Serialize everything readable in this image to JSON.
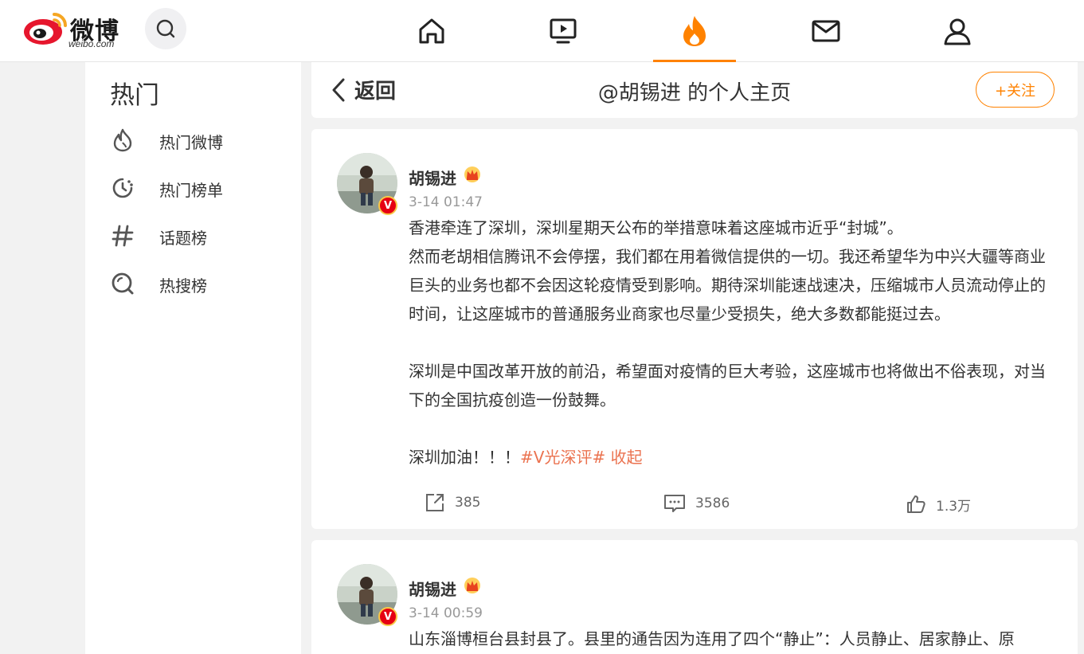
{
  "brand": {
    "logo_text": "微博",
    "logo_sub": "weibo.com"
  },
  "colors": {
    "accent": "#ff8200",
    "topic": "#eb7350",
    "verified": "#e60012"
  },
  "topnav": [
    {
      "name": "home",
      "icon": "home-icon"
    },
    {
      "name": "video",
      "icon": "video-icon"
    },
    {
      "name": "hot",
      "icon": "fire-icon",
      "active": true
    },
    {
      "name": "messages",
      "icon": "mail-icon"
    },
    {
      "name": "profile",
      "icon": "user-icon"
    }
  ],
  "sidebar": {
    "title": "热门",
    "items": [
      {
        "label": "热门微博",
        "icon": "flame-icon"
      },
      {
        "label": "热门榜单",
        "icon": "clock-icon"
      },
      {
        "label": "话题榜",
        "icon": "hashtag-icon"
      },
      {
        "label": "热搜榜",
        "icon": "search-ring-icon"
      }
    ]
  },
  "header": {
    "back_label": "返回",
    "title": "@胡锡进 的个人主页",
    "follow_label": "+关注"
  },
  "posts": [
    {
      "author": "胡锡进",
      "time": "3-14 01:47",
      "paragraphs": [
        "香港牵连了深圳，深圳星期天公布的举措意味着这座城市近乎“封城”。",
        "然而老胡相信腾讯不会停摆，我们都在用着微信提供的一切。我还希望华为中兴大疆等商业巨头的业务也都不会因这轮疫情受到影响。期待深圳能速战速决，压缩城市人员流动停止的时间，让这座城市的普通服务业商家也尽量少受损失，绝大多数都能挺过去。",
        "深圳是中国改革开放的前沿，希望面对疫情的巨大考验，这座城市也将做出不俗表现，对当下的全国抗疫创造一份鼓舞。",
        "深圳加油！！！"
      ],
      "topic": "#V光深评#",
      "collapse": "收起",
      "reposts": "385",
      "comments": "3586",
      "likes": "1.3万"
    },
    {
      "author": "胡锡进",
      "time": "3-14 00:59",
      "first_line": "山东淄博桓台县封县了。县里的通告因为连用了四个“静止”：人员静止、居家静止、原"
    }
  ]
}
